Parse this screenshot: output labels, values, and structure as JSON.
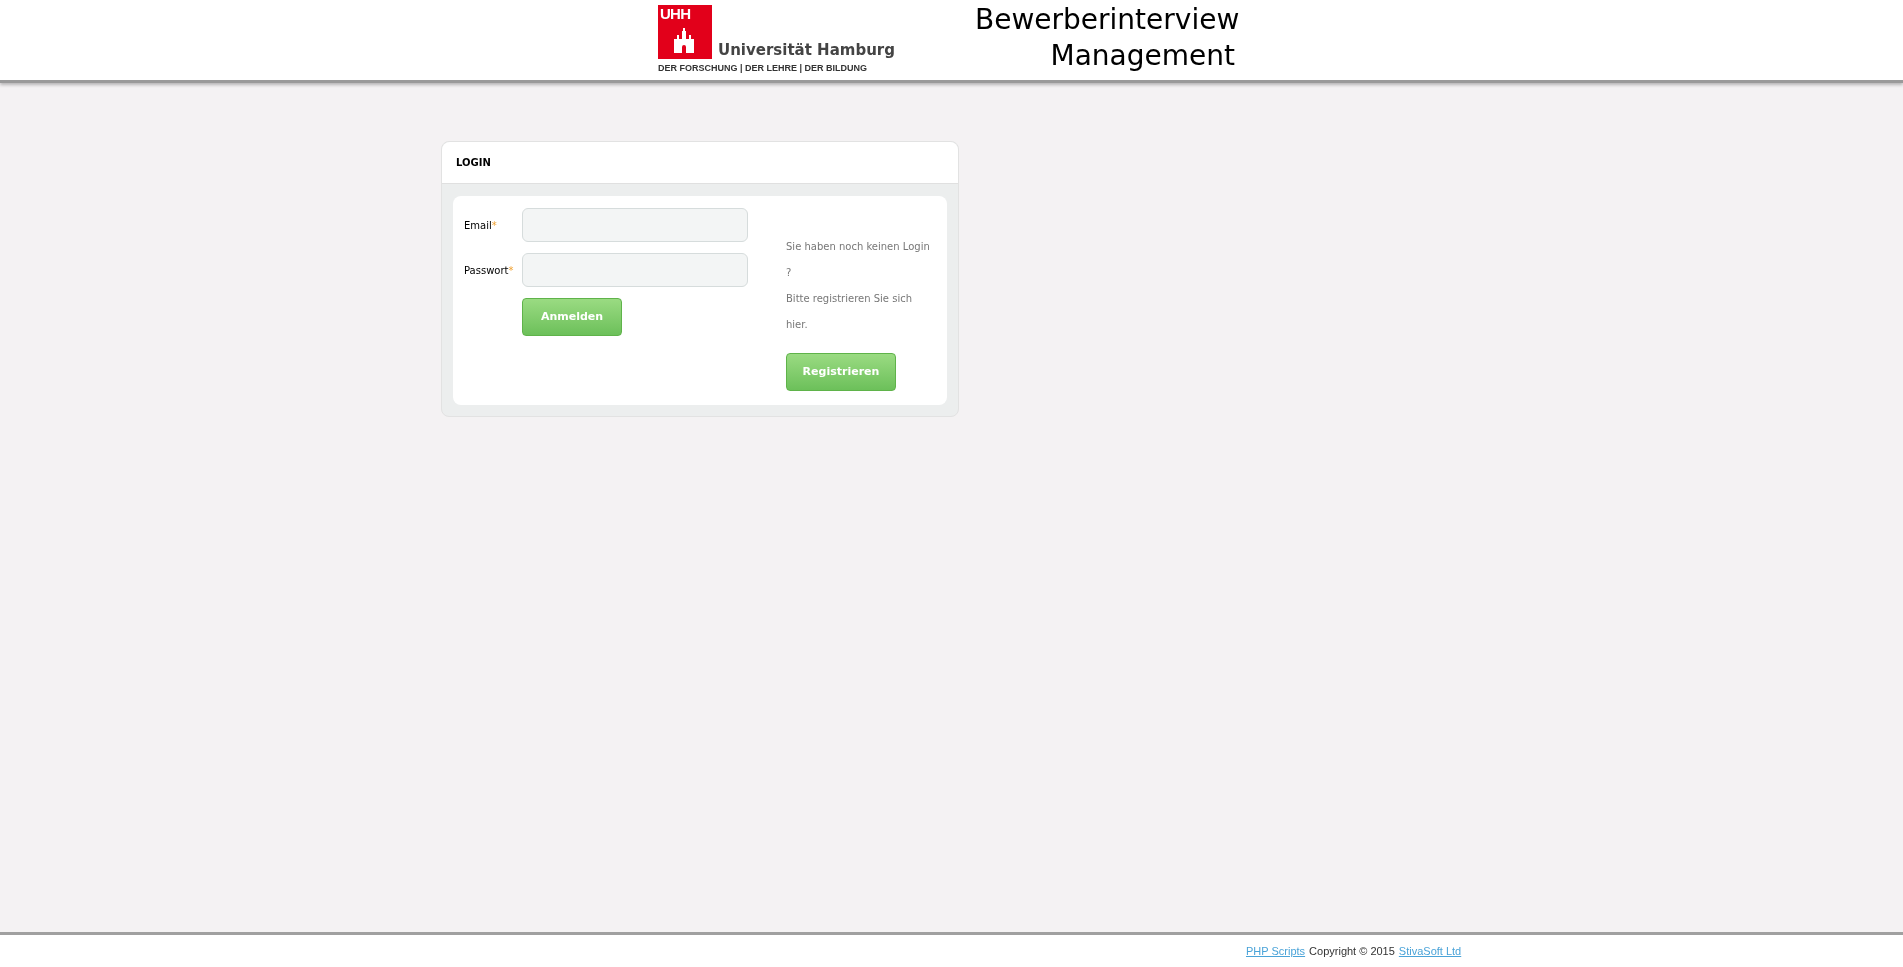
{
  "header": {
    "logo_mark": "UHH",
    "logo_name": "Universität Hamburg",
    "logo_tagline": "DER FORSCHUNG | DER LEHRE | DER BILDUNG",
    "title_lines": [
      "Bewerberinterview",
      "Management"
    ]
  },
  "login": {
    "title": "LOGIN",
    "fields": [
      {
        "label": "Email",
        "required_mark": "*"
      },
      {
        "label": "Passwort",
        "required_mark": "*"
      }
    ],
    "submit": "Anmelden",
    "register_text_lines": [
      "Sie haben noch keinen Login",
      "?",
      "Bitte registrieren Sie sich",
      "hier."
    ],
    "register_button": "Registrieren"
  },
  "footer": {
    "link_1": "PHP Scripts",
    "text": "Copyright © 2015",
    "link_2": "StivaSoft Ltd"
  }
}
